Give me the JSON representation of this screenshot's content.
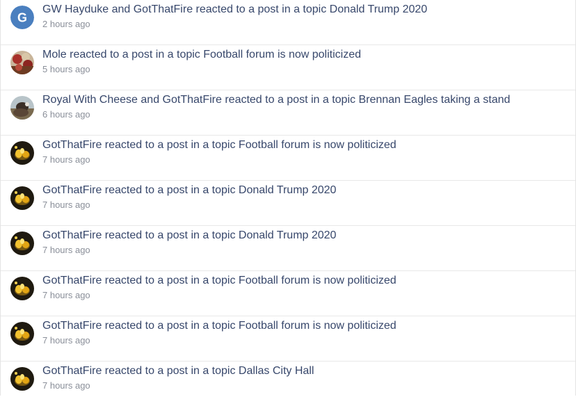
{
  "notifications": [
    {
      "text": "GW Hayduke and GotThatFire reacted to a post in a topic Donald Trump 2020",
      "time": "2 hours ago",
      "avatar": "letter-avatar",
      "avatar_letter": "G",
      "avatar_color": "#4a7fbf"
    },
    {
      "text": "Mole reacted to a post in a topic Football forum is now politicized",
      "time": "5 hours ago",
      "avatar": "photo-avatar-mole"
    },
    {
      "text": "Royal With Cheese and GotThatFire reacted to a post in a topic Brennan Eagles taking a stand",
      "time": "6 hours ago",
      "avatar": "photo-avatar-royal"
    },
    {
      "text": "GotThatFire reacted to a post in a topic Football forum is now politicized",
      "time": "7 hours ago",
      "avatar": "photo-avatar-fire"
    },
    {
      "text": "GotThatFire reacted to a post in a topic Donald Trump 2020",
      "time": "7 hours ago",
      "avatar": "photo-avatar-fire"
    },
    {
      "text": "GotThatFire reacted to a post in a topic Donald Trump 2020",
      "time": "7 hours ago",
      "avatar": "photo-avatar-fire"
    },
    {
      "text": "GotThatFire reacted to a post in a topic Football forum is now politicized",
      "time": "7 hours ago",
      "avatar": "photo-avatar-fire"
    },
    {
      "text": "GotThatFire reacted to a post in a topic Football forum is now politicized",
      "time": "7 hours ago",
      "avatar": "photo-avatar-fire"
    },
    {
      "text": "GotThatFire reacted to a post in a topic Dallas City Hall",
      "time": "7 hours ago",
      "avatar": "photo-avatar-fire"
    }
  ],
  "colors": {
    "link": "#37476b",
    "muted": "#8a8f99",
    "divider": "#e8e8e8"
  }
}
